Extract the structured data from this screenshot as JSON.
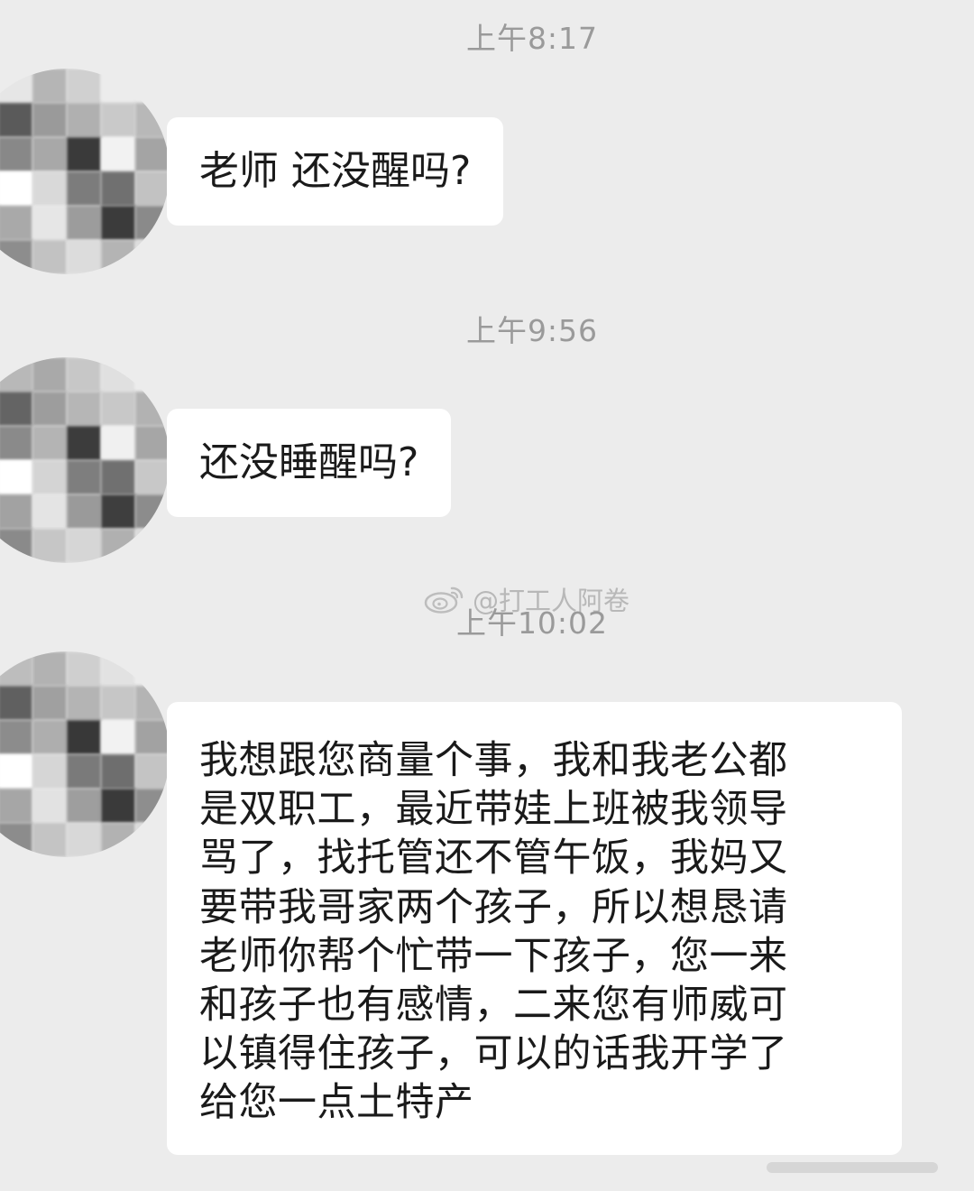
{
  "timestamps": [
    "上午8:17",
    "上午9:56",
    "上午10:02"
  ],
  "messages": {
    "m1": "老师 还没醒吗?",
    "m2": "还没睡醒吗?",
    "m3_lines": [
      "我想跟您商量个事，我和我老公都",
      "是双职工，最近带娃上班被我领导",
      "骂了，找托管还不管午饭，我妈又",
      "要带我哥家两个孩子，所以想恳请",
      "老师你帮个忙带一下孩子，您一来",
      "和孩子也有感情，二来您有师威可",
      "以镇得住孩子，可以的话我开学了",
      "给您一点土特产"
    ]
  },
  "watermark": {
    "text": "@打工人阿卷",
    "icon": "weibo-icon"
  },
  "avatar": {
    "icon": "pixelated-avatar-icon"
  }
}
